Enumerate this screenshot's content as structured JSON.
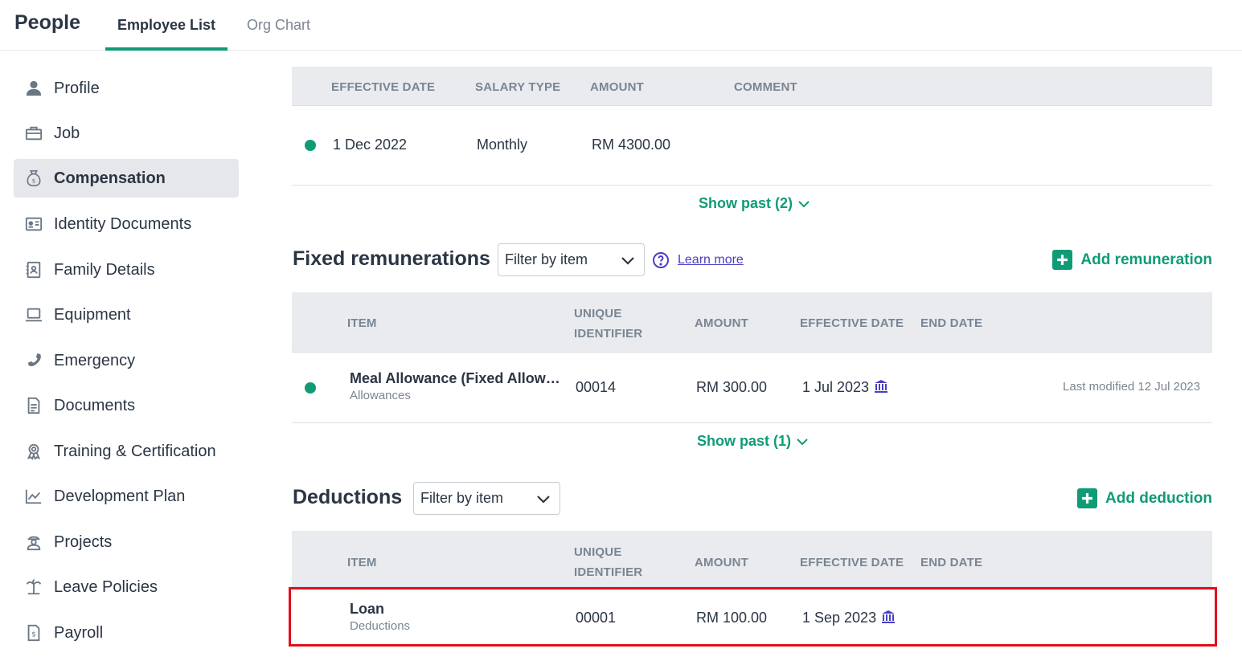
{
  "header": {
    "app_title": "People",
    "tabs": [
      {
        "label": "Employee List",
        "active": true
      },
      {
        "label": "Org Chart",
        "active": false
      }
    ]
  },
  "sidebar": {
    "items": [
      {
        "label": "Profile",
        "icon": "person-icon"
      },
      {
        "label": "Job",
        "icon": "briefcase-icon"
      },
      {
        "label": "Compensation",
        "icon": "money-bag-icon",
        "active": true
      },
      {
        "label": "Identity Documents",
        "icon": "id-card-icon"
      },
      {
        "label": "Family Details",
        "icon": "contact-book-icon"
      },
      {
        "label": "Equipment",
        "icon": "laptop-icon"
      },
      {
        "label": "Emergency",
        "icon": "phone-icon"
      },
      {
        "label": "Documents",
        "icon": "document-icon"
      },
      {
        "label": "Training & Certification",
        "icon": "award-icon"
      },
      {
        "label": "Development Plan",
        "icon": "chart-line-icon"
      },
      {
        "label": "Projects",
        "icon": "worker-icon"
      },
      {
        "label": "Leave Policies",
        "icon": "palm-tree-icon"
      },
      {
        "label": "Payroll",
        "icon": "payslip-icon"
      }
    ]
  },
  "salary": {
    "columns": [
      "EFFECTIVE DATE",
      "SALARY TYPE",
      "AMOUNT",
      "COMMENT"
    ],
    "rows": [
      {
        "effective_date": "1 Dec 2022",
        "salary_type": "Monthly",
        "amount": "RM 4300.00",
        "comment": ""
      }
    ],
    "show_past": "Show past (2)"
  },
  "fixed": {
    "title": "Fixed remunerations",
    "filter_value": "Filter by item",
    "learn_more": "Learn more",
    "add_label": "Add remuneration",
    "columns": {
      "item": "ITEM",
      "uid_1": "UNIQUE",
      "uid_2": "IDENTIFIER",
      "amount": "AMOUNT",
      "effective_date": "EFFECTIVE DATE",
      "end_date": "END DATE"
    },
    "rows": [
      {
        "item": "Meal Allowance (Fixed Allow…",
        "category": "Allowances",
        "uid": "00014",
        "amount": "RM 300.00",
        "effective_date": "1 Jul 2023",
        "end_date": "",
        "modified": "Last modified 12 Jul 2023"
      }
    ],
    "show_past": "Show past (1)"
  },
  "deductions": {
    "title": "Deductions",
    "filter_value": "Filter by item",
    "add_label": "Add deduction",
    "columns": {
      "item": "ITEM",
      "uid_1": "UNIQUE",
      "uid_2": "IDENTIFIER",
      "amount": "AMOUNT",
      "effective_date": "EFFECTIVE DATE",
      "end_date": "END DATE"
    },
    "rows": [
      {
        "item": "Loan",
        "category": "Deductions",
        "uid": "00001",
        "amount": "RM 100.00",
        "effective_date": "1 Sep 2023",
        "end_date": ""
      }
    ]
  },
  "colors": {
    "accent": "#0f9b76",
    "link": "#4a3fc1",
    "highlight": "#e0101d"
  }
}
